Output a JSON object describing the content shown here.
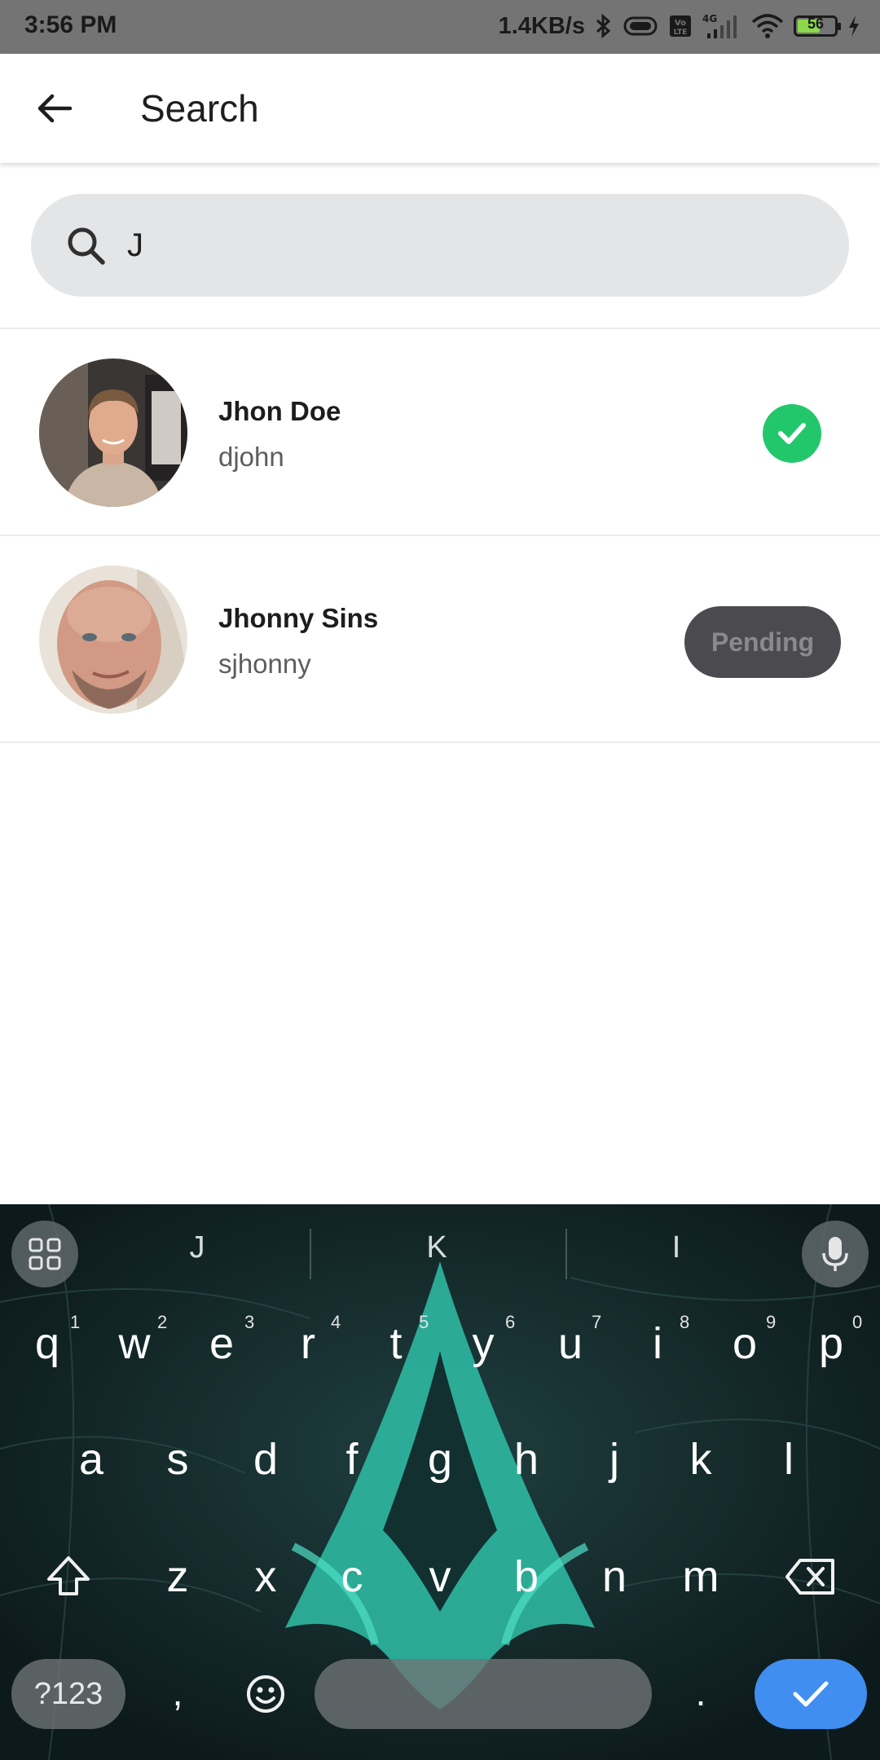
{
  "status_bar": {
    "time": "3:56 PM",
    "network_speed": "1.4KB/s",
    "network_type": "4G",
    "volte": "Vo LTE",
    "battery_level": "56",
    "icons": [
      "bluetooth-icon",
      "vibrate-icon",
      "volte-icon",
      "signal-icon",
      "wifi-icon",
      "battery-icon",
      "charging-icon"
    ]
  },
  "app_bar": {
    "title": "Search",
    "back_icon": "arrow-left-icon"
  },
  "search": {
    "value": "J",
    "icon": "search-icon"
  },
  "results": [
    {
      "name": "Jhon Doe",
      "username": "djohn",
      "status": "friend",
      "status_icon": "check-circle-icon",
      "status_color": "#22c76b"
    },
    {
      "name": "Jhonny Sins",
      "username": "sjhonny",
      "status": "pending",
      "action_label": "Pending"
    }
  ],
  "keyboard": {
    "suggestions": [
      "J",
      "K",
      "I"
    ],
    "row1": [
      "q",
      "w",
      "e",
      "r",
      "t",
      "y",
      "u",
      "i",
      "o",
      "p"
    ],
    "row1_hints": [
      "1",
      "2",
      "3",
      "4",
      "5",
      "6",
      "7",
      "8",
      "9",
      "0"
    ],
    "row2": [
      "a",
      "s",
      "d",
      "f",
      "g",
      "h",
      "j",
      "k",
      "l"
    ],
    "row3": [
      "z",
      "x",
      "c",
      "v",
      "b",
      "n",
      "m"
    ],
    "symbols_label": "?123",
    "comma": ",",
    "period": ".",
    "icons": [
      "apps-grid-icon",
      "microphone-icon",
      "shift-icon",
      "backspace-icon",
      "emoji-icon",
      "checkmark-icon"
    ],
    "enter_color": "#3f8ef0"
  }
}
